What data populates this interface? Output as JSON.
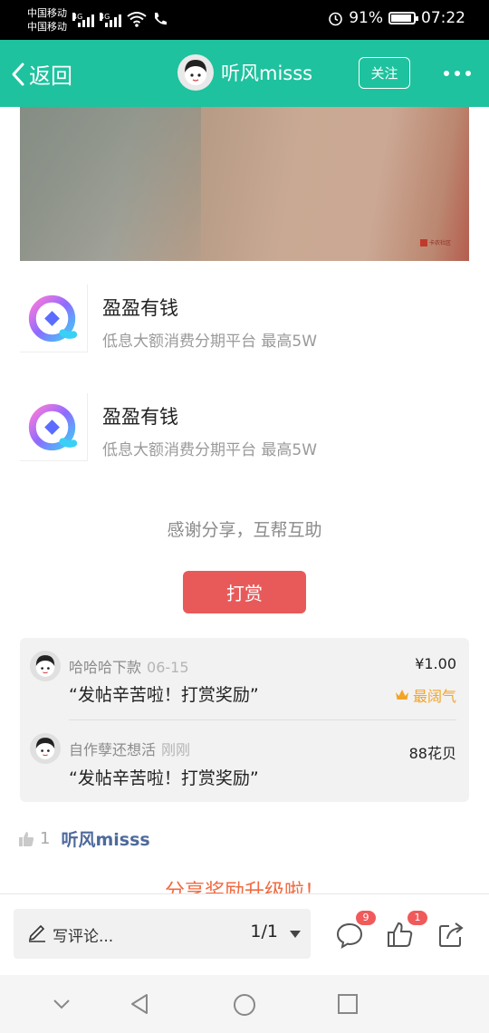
{
  "status_bar": {
    "carrier_1": "中国移动",
    "carrier_2": "中国移动",
    "network_1": "4G",
    "network_2": "4G",
    "battery": "91%",
    "battery_level": 0.91,
    "time": "07:22"
  },
  "header": {
    "back_label": "返回",
    "title": "听风misss",
    "follow_label": "关注",
    "bg_color": "#1ec29e"
  },
  "apps": [
    {
      "name": "盈盈有钱",
      "desc": "低息大额消费分期平台 最高5W"
    },
    {
      "name": "盈盈有钱",
      "desc": "低息大额消费分期平台 最高5W"
    }
  ],
  "thanks_text": "感谢分享，互帮互助",
  "reward_button": "打赏",
  "rewards": [
    {
      "user": "哈哈哈下款",
      "time": "06-15",
      "message": "“发帖辛苦啦！打赏奖励”",
      "amount": "¥1.00",
      "badge": "最阔气"
    },
    {
      "user": "自作孽还想活",
      "time": "刚刚",
      "message": "“发帖辛苦啦！打赏奖励”",
      "amount": "88花贝"
    }
  ],
  "likes": {
    "count": "1",
    "liker": "听风misss"
  },
  "promo_text": "分享奖励升级啦！",
  "bottom_bar": {
    "comment_placeholder": "写评论...",
    "page": "1/1",
    "comment_count": "9",
    "like_count": "1"
  },
  "icons": [
    "back-icon",
    "more-icon",
    "pen-icon",
    "comment-icon",
    "thumb-up-icon",
    "share-icon",
    "crown-icon"
  ]
}
